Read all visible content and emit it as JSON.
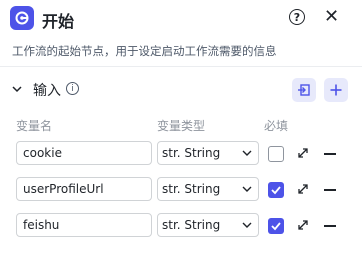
{
  "header": {
    "title": "开始",
    "help_symbol": "?",
    "close_symbol": "✕"
  },
  "description": "工作流的起始节点，用于设定启动工作流需要的信息",
  "inputs": {
    "section_title": "输入",
    "info_symbol": "i",
    "columns": {
      "name": "变量名",
      "type": "变量类型",
      "required": "必填"
    },
    "rows": [
      {
        "name": "cookie",
        "type": "str. String",
        "required": false
      },
      {
        "name": "userProfileUrl",
        "type": "str. String",
        "required": true
      },
      {
        "name": "feishu",
        "type": "str. String",
        "required": true
      }
    ]
  },
  "colors": {
    "accent": "#4d53e8",
    "accent_light": "#e7e9fb"
  }
}
